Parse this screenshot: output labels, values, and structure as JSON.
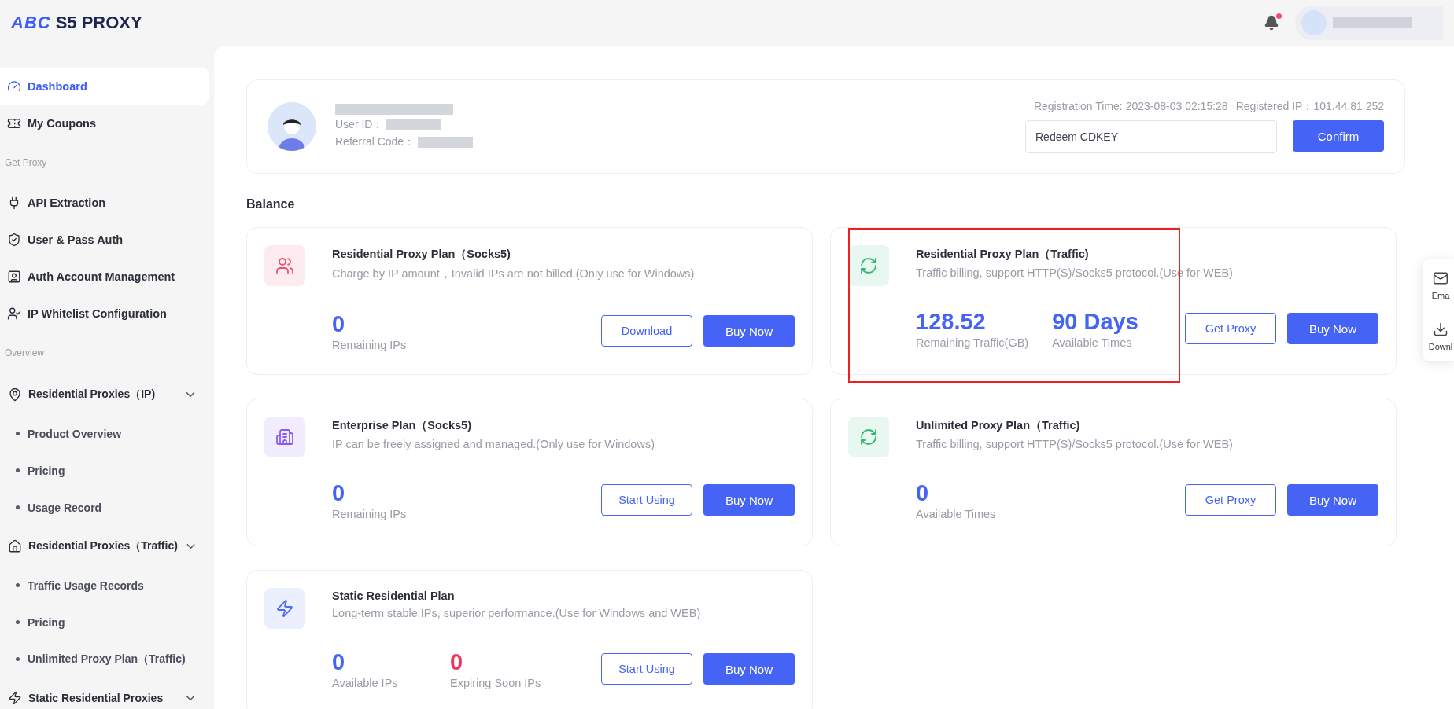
{
  "header": {
    "logo_mark": "ABC",
    "logo_text": "S5 PROXY",
    "notifications": {
      "unread": true
    }
  },
  "sidebar": {
    "items": [
      {
        "kind": "link",
        "label": "Dashboard",
        "selected": true
      },
      {
        "kind": "link",
        "label": "My Coupons",
        "selected": false
      },
      {
        "kind": "section",
        "label": "Get Proxy"
      },
      {
        "kind": "link",
        "label": "API Extraction",
        "selected": false
      },
      {
        "kind": "link",
        "label": "User & Pass Auth",
        "selected": false
      },
      {
        "kind": "link",
        "label": "Auth Account Management",
        "selected": false
      },
      {
        "kind": "link",
        "label": "IP Whitelist Configuration",
        "selected": false
      },
      {
        "kind": "section",
        "label": "Overview"
      },
      {
        "kind": "group",
        "label": "Residential Proxies（IP)",
        "expanded": true,
        "children": [
          {
            "label": "Product Overview"
          },
          {
            "label": "Pricing"
          },
          {
            "label": "Usage Record"
          }
        ]
      },
      {
        "kind": "group",
        "label": "Residential Proxies（Traffic)",
        "expanded": true,
        "children": [
          {
            "label": "Traffic Usage Records"
          },
          {
            "label": "Pricing"
          },
          {
            "label": "Unlimited Proxy Plan（Traffic)"
          }
        ]
      },
      {
        "kind": "group",
        "label": "Static Residential Proxies",
        "expanded": true
      }
    ]
  },
  "profile": {
    "user_id_label": "User ID：",
    "referral_label": "Referral Code：",
    "registration": "Registration Time: 2023-08-03 02:15:28",
    "registered_ip": "Registered IP：101.44.81.252",
    "cdkey": {
      "placeholder": "Redeem CDKEY"
    },
    "confirm": "Confirm"
  },
  "balance": {
    "title": "Balance",
    "plans": [
      {
        "title": "Residential Proxy Plan（Socks5)",
        "description": "Charge by IP amount，Invalid IPs are not billed.(Only use for Windows)",
        "color": "#f0506e",
        "highlighted": false,
        "stats": [
          {
            "value": "0",
            "label": "Remaining IPs",
            "color": "#4563f5"
          }
        ],
        "buttons": [
          {
            "label": "Download",
            "kind": "outline"
          },
          {
            "label": "Buy Now",
            "kind": "primary"
          }
        ]
      },
      {
        "title": "Residential Proxy Plan（Traffic)",
        "description": "Traffic billing, support HTTP(S)/Socks5 protocol.(Use for WEB)",
        "color": "#2eb872",
        "highlighted": true,
        "stats": [
          {
            "value": "128.52",
            "label": "Remaining Traffic(GB)",
            "color": "#4563f5"
          },
          {
            "value": "90 Days",
            "label": "Available Times",
            "color": "#4563f5"
          }
        ],
        "buttons": [
          {
            "label": "Get Proxy",
            "kind": "outline"
          },
          {
            "label": "Buy Now",
            "kind": "primary"
          }
        ]
      },
      {
        "title": "Enterprise Plan（Socks5)",
        "description": "IP can be freely assigned and managed.(Only use for Windows)",
        "color": "#8a5cf5",
        "highlighted": false,
        "stats": [
          {
            "value": "0",
            "label": "Remaining IPs",
            "color": "#4563f5"
          }
        ],
        "buttons": [
          {
            "label": "Start Using",
            "kind": "outline"
          },
          {
            "label": "Buy Now",
            "kind": "primary"
          }
        ]
      },
      {
        "title": "Unlimited Proxy Plan（Traffic)",
        "description": "Traffic billing, support HTTP(S)/Socks5 protocol.(Use for WEB)",
        "color": "#2eb872",
        "highlighted": false,
        "stats": [
          {
            "value": "0",
            "label": "Available Times",
            "color": "#4563f5"
          }
        ],
        "buttons": [
          {
            "label": "Get Proxy",
            "kind": "outline"
          },
          {
            "label": "Buy Now",
            "kind": "primary"
          }
        ]
      },
      {
        "title": "Static Residential Plan",
        "description": "Long-term stable IPs, superior performance.(Use for Windows and WEB)",
        "color": "#4a6cf7",
        "highlighted": false,
        "stats": [
          {
            "value": "0",
            "label": "Available IPs",
            "color": "#4563f5"
          },
          {
            "value": "0",
            "label": "Expiring Soon IPs",
            "color": "#f0345a"
          }
        ],
        "buttons": [
          {
            "label": "Start Using",
            "kind": "outline"
          },
          {
            "label": "Buy Now",
            "kind": "primary"
          }
        ]
      }
    ]
  },
  "float_panel": [
    {
      "label": "Ema"
    },
    {
      "label": "Downl"
    }
  ]
}
